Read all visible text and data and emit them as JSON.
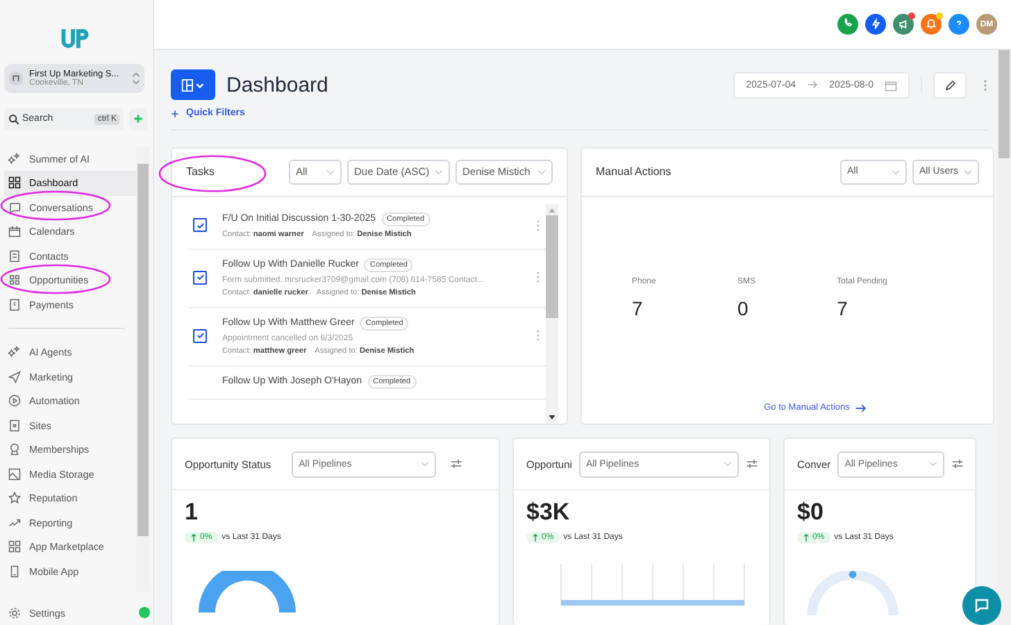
{
  "sidebar": {
    "account": {
      "name": "First Up Marketing S...",
      "location": "Cookeville, TN"
    },
    "search": {
      "placeholder": "Search",
      "shortcut": "ctrl K"
    },
    "nav_groups": [
      [
        {
          "label": "Summer of AI",
          "selected": false
        },
        {
          "label": "Dashboard",
          "selected": true
        },
        {
          "label": "Conversations",
          "selected": false
        },
        {
          "label": "Calendars",
          "selected": false
        },
        {
          "label": "Contacts",
          "selected": false
        },
        {
          "label": "Opportunities",
          "selected": false
        },
        {
          "label": "Payments",
          "selected": false
        }
      ],
      [
        {
          "label": "AI Agents",
          "selected": false
        },
        {
          "label": "Marketing",
          "selected": false
        },
        {
          "label": "Automation",
          "selected": false
        },
        {
          "label": "Sites",
          "selected": false
        },
        {
          "label": "Memberships",
          "selected": false
        },
        {
          "label": "Media Storage",
          "selected": false
        },
        {
          "label": "Reputation",
          "selected": false
        },
        {
          "label": "Reporting",
          "selected": false
        },
        {
          "label": "App Marketplace",
          "selected": false
        },
        {
          "label": "Mobile App",
          "selected": false
        }
      ]
    ],
    "settings": "Settings"
  },
  "topbar": {
    "actions": [
      {
        "kind": "phone",
        "color": "#16a34a",
        "badge": false
      },
      {
        "kind": "lightning",
        "color": "#155eef",
        "badge": false
      },
      {
        "kind": "megaphone",
        "color": "#3f8f6e",
        "badge": true
      },
      {
        "kind": "bell",
        "color": "#f97316",
        "badge": true
      },
      {
        "kind": "help",
        "color": "#1d8cf8",
        "badge": false
      }
    ],
    "avatar": "DM"
  },
  "header": {
    "title": "Dashboard",
    "quick_filters": "Quick Filters",
    "date_start": "2025-07-04",
    "date_end": "2025-08-0"
  },
  "tasks": {
    "title": "Tasks",
    "filters": [
      "All",
      "Due Date (ASC)",
      "Denise Mistich"
    ],
    "items": [
      {
        "title": "F/U On Initial Discussion 1-30-2025",
        "status": "Completed",
        "checked": true,
        "contact": "Contact: **naomi warner**",
        "assigned": "Assigned to: **Denise Mistich**"
      },
      {
        "title": "Follow Up With Danielle Rucker",
        "status": "Completed",
        "checked": true,
        "note": "Form submitted. mrsrucker3709@gmail.com (708) 614-7585 Contact...",
        "contact": "Contact: **danielle rucker**",
        "assigned": "Assigned to: **Denise Mistich**"
      },
      {
        "title": "Follow Up With Matthew Greer",
        "status": "Completed",
        "checked": true,
        "note": "Appointment cancelled on 6/3/2025",
        "contact": "Contact: **matthew greer**",
        "assigned": "Assigned to: **Denise Mistich**"
      },
      {
        "title": "Follow Up With Joseph O'Hayon",
        "status": "Completed"
      }
    ]
  },
  "manual_actions": {
    "title": "Manual Actions",
    "filters": [
      "All",
      "All Users"
    ],
    "stats": [
      {
        "label": "Phone",
        "value": "7"
      },
      {
        "label": "SMS",
        "value": "0"
      },
      {
        "label": "Total Pending",
        "value": "7"
      }
    ],
    "link": "Go to Manual Actions"
  },
  "widgets": [
    {
      "kind": "donut",
      "title": "Opportunity Status",
      "pipeline": "All Pipelines",
      "value": "1",
      "change": "0%",
      "compare": "vs Last 31 Days"
    },
    {
      "kind": "bar",
      "title": "Opportuni",
      "pipeline": "All Pipelines",
      "value": "$3K",
      "change": "0%",
      "compare": "vs Last 31 Days"
    },
    {
      "kind": "ring",
      "title": "Conver",
      "pipeline": "All Pipelines",
      "value": "$0",
      "change": "0%",
      "compare": "vs Last 31 Days"
    }
  ]
}
